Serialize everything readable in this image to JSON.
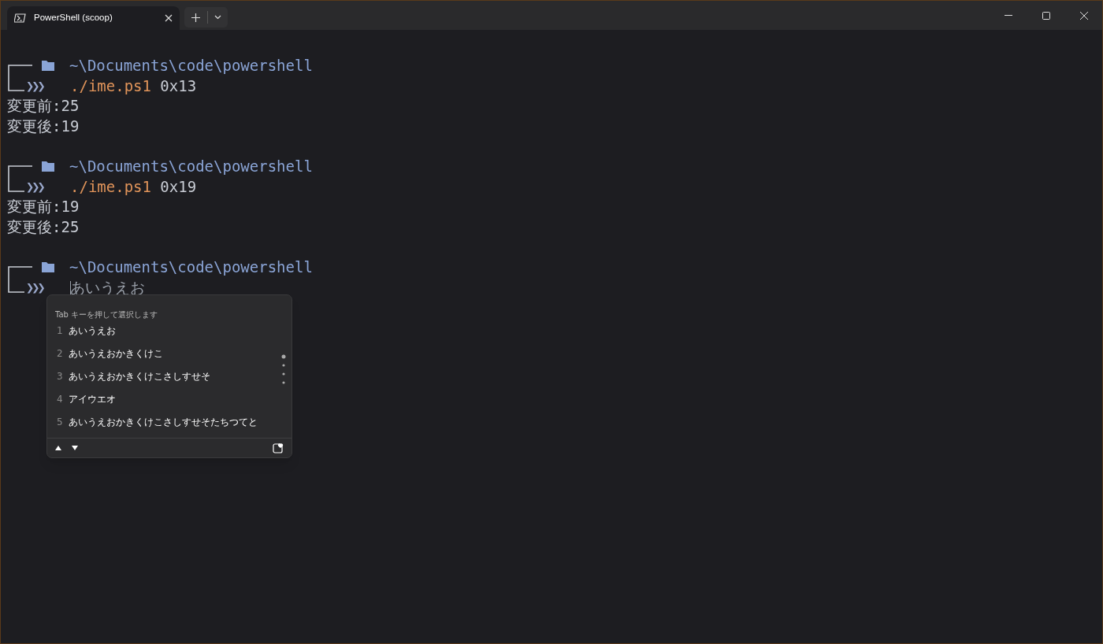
{
  "tab": {
    "title": "PowerShell (scoop)",
    "selected": true
  },
  "blocks": [
    {
      "path": "~\\Documents\\code\\powershell",
      "prompt_symbol": "❯❯❯",
      "script": "./ime.ps1",
      "args": "0x13",
      "output": [
        "変更前:25",
        "変更後:19"
      ]
    },
    {
      "path": "~\\Documents\\code\\powershell",
      "prompt_symbol": "❯❯❯",
      "script": "./ime.ps1",
      "args": "0x19",
      "output": [
        "変更前:19",
        "変更後:25"
      ]
    },
    {
      "path": "~\\Documents\\code\\powershell",
      "prompt_symbol": "❯❯❯",
      "composing": "あいうえお"
    }
  ],
  "ime_popup": {
    "hint": "Tab キーを押して選択します",
    "candidates": [
      {
        "number": "1",
        "text": "あいうえお"
      },
      {
        "number": "2",
        "text": "あいうえおかきくけこ"
      },
      {
        "number": "3",
        "text": "あいうえおかきくけこさしすせそ"
      },
      {
        "number": "4",
        "text": "アイウエオ"
      },
      {
        "number": "5",
        "text": "あいうえおかきくけこさしすせそたちつてと"
      }
    ]
  }
}
